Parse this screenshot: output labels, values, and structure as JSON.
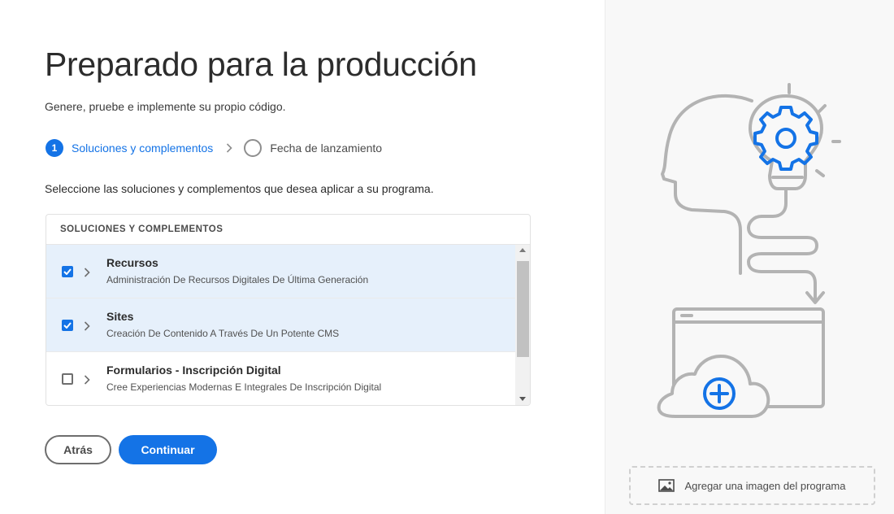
{
  "page": {
    "title": "Preparado para la producción",
    "subtitle": "Genere, pruebe e implemente su propio código."
  },
  "stepper": {
    "steps": [
      {
        "number": "1",
        "label": "Soluciones y complementos",
        "active": true
      },
      {
        "number": "",
        "label": "Fecha de lanzamiento",
        "active": false
      }
    ]
  },
  "instruction": "Seleccione las soluciones y complementos que desea aplicar a su programa.",
  "table": {
    "header": "SOLUCIONES Y COMPLEMENTOS",
    "rows": [
      {
        "title": "Recursos",
        "description": "Administración De Recursos Digitales De Última Generación",
        "checked": true
      },
      {
        "title": "Sites",
        "description": "Creación De Contenido A Través De Un Potente CMS",
        "checked": true
      },
      {
        "title": "Formularios - Inscripción Digital",
        "description": "Cree Experiencias Modernas E Integrales De Inscripción Digital",
        "checked": false
      }
    ]
  },
  "buttons": {
    "back": "Atrás",
    "continue": "Continuar"
  },
  "sidebar": {
    "add_image_label": "Agregar una imagen del programa"
  },
  "colors": {
    "accent": "#1473e6",
    "selected_row": "#e6f0fb",
    "illustration_stroke": "#b3b3b3"
  },
  "icons": {
    "step_chevron": "chevron-right-icon",
    "row_chevron": "chevron-right-icon",
    "add_image": "image-icon",
    "illustration": "head-lightbulb-gear-cloud-illustration"
  }
}
